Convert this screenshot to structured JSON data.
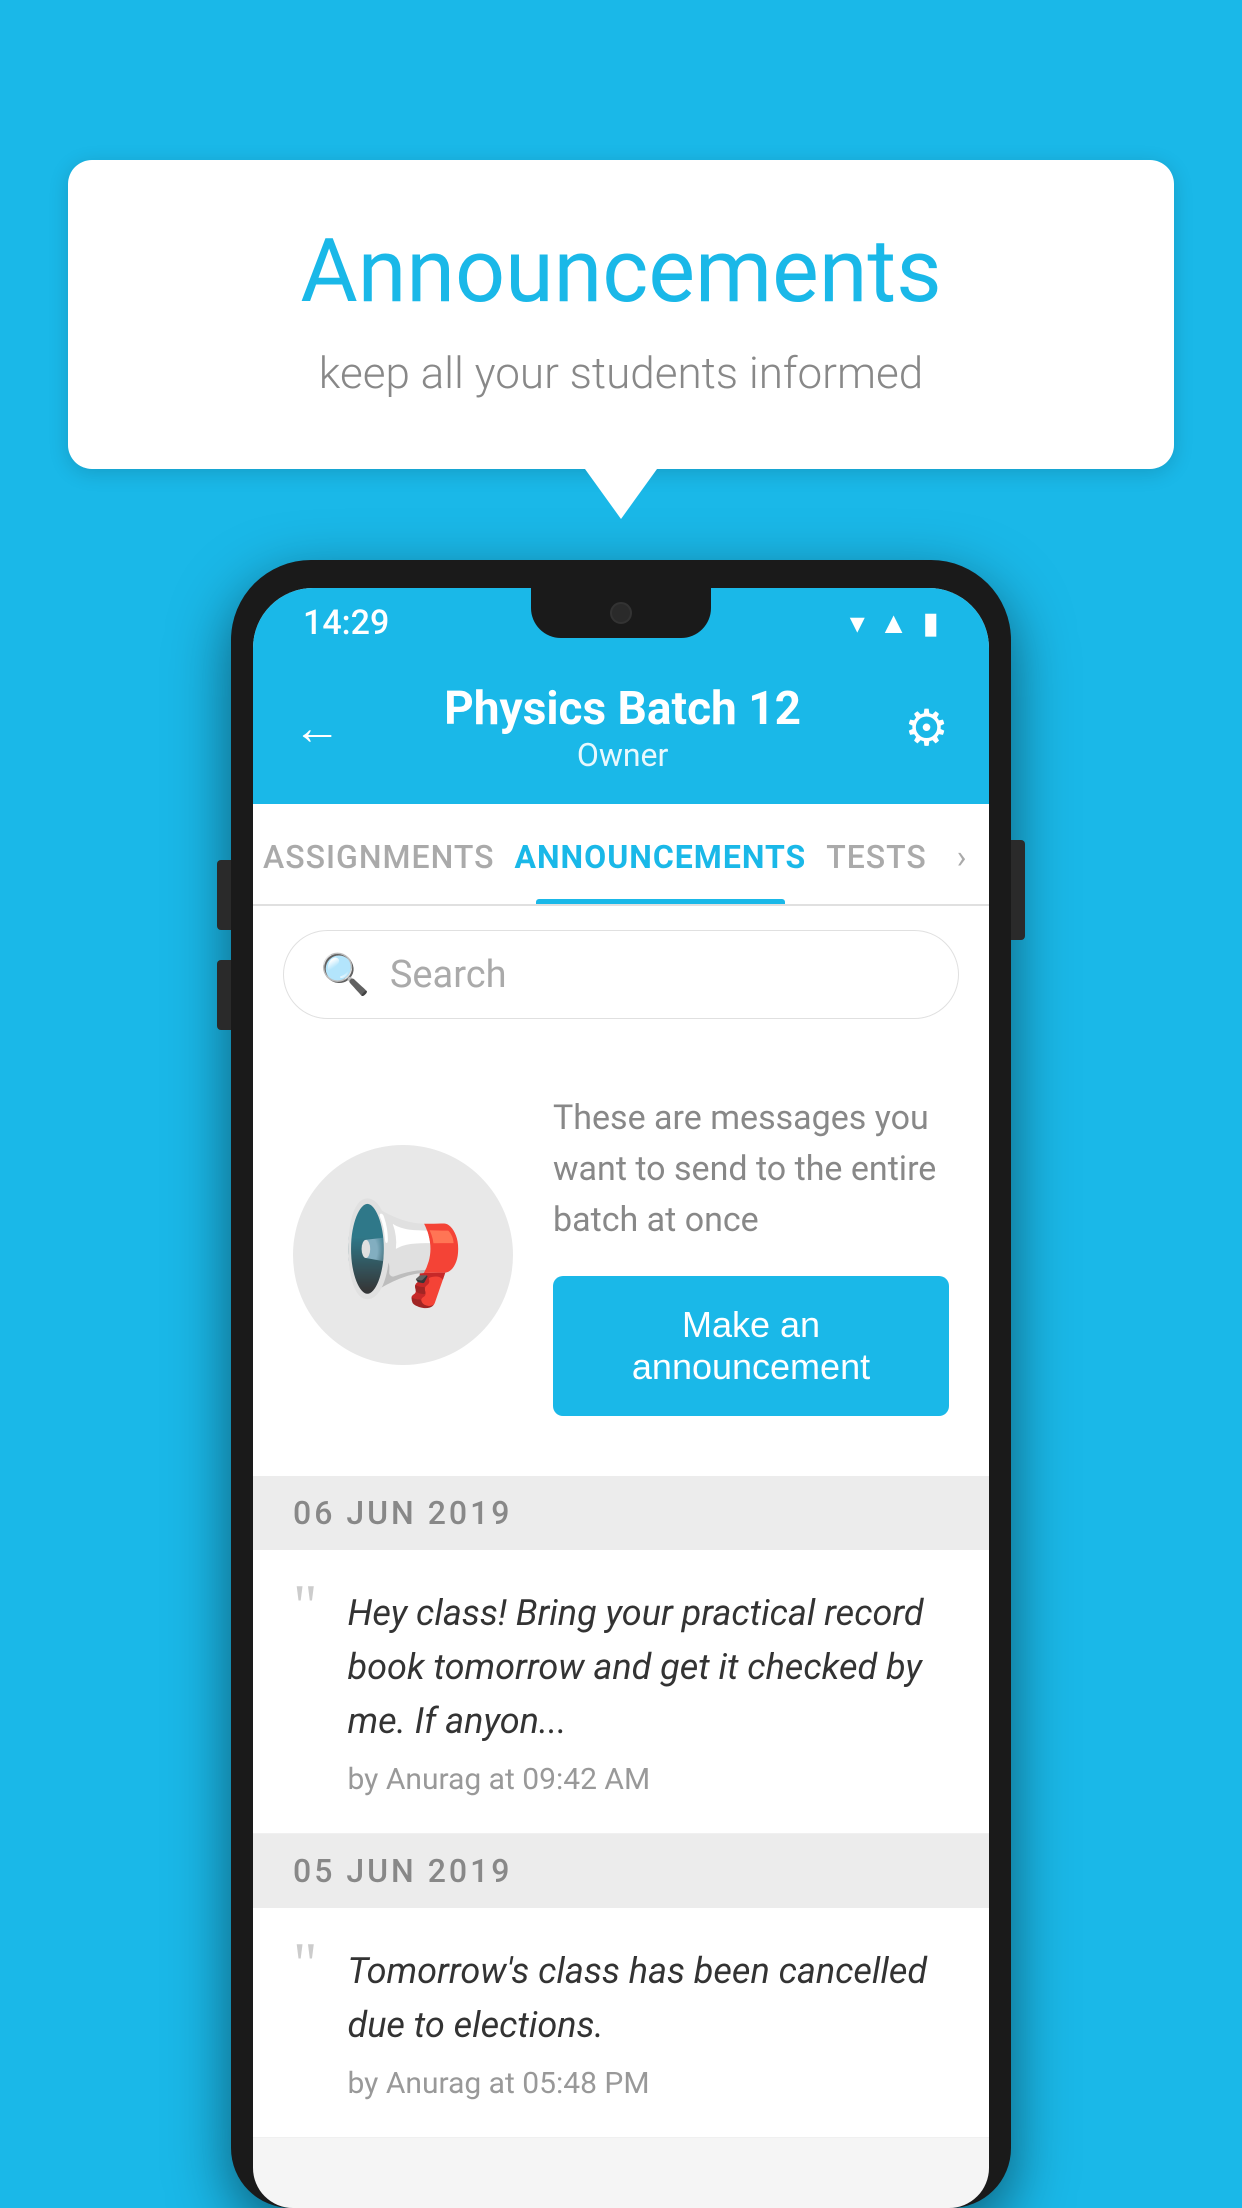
{
  "bubble": {
    "title": "Announcements",
    "subtitle": "keep all your students informed"
  },
  "status_bar": {
    "time": "14:29"
  },
  "header": {
    "title": "Physics Batch 12",
    "subtitle": "Owner",
    "back_label": "←",
    "settings_label": "⚙"
  },
  "tabs": [
    {
      "label": "ASSIGNMENTS",
      "active": false
    },
    {
      "label": "ANNOUNCEMENTS",
      "active": true
    },
    {
      "label": "TESTS",
      "active": false
    }
  ],
  "search": {
    "placeholder": "Search"
  },
  "promo": {
    "description": "These are messages you want to send to the entire batch at once",
    "button_label": "Make an announcement"
  },
  "date_groups": [
    {
      "date": "06  JUN  2019",
      "items": [
        {
          "message": "Hey class! Bring your practical record book tomorrow and get it checked by me. If anyon...",
          "meta": "by Anurag at 09:42 AM"
        }
      ]
    },
    {
      "date": "05  JUN  2019",
      "items": [
        {
          "message": "Tomorrow's class has been cancelled due to elections.",
          "meta": "by Anurag at 05:48 PM"
        }
      ]
    }
  ],
  "colors": {
    "brand": "#1ab8e8",
    "bg": "#1ab8e8"
  }
}
